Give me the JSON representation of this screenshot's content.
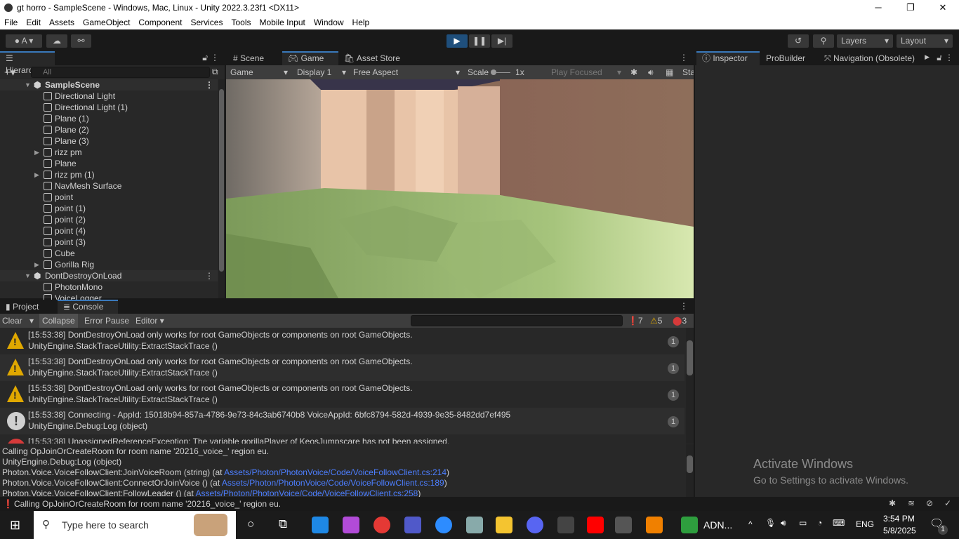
{
  "window": {
    "title": "gt horro - SampleScene - Windows, Mac, Linux - Unity 2022.3.23f1 <DX11>",
    "minimize": "─",
    "maximize": "❐",
    "close": "✕"
  },
  "menu": [
    "File",
    "Edit",
    "Assets",
    "GameObject",
    "Component",
    "Services",
    "Tools",
    "Mobile Input",
    "Window",
    "Help"
  ],
  "toolbar": {
    "account": "A",
    "layers": "Layers",
    "layout": "Layout"
  },
  "hierarchy": {
    "tab": "Hierarchy",
    "search_placeholder": "All",
    "scene": "SampleScene",
    "items": [
      {
        "label": "Directional Light"
      },
      {
        "label": "Directional Light (1)"
      },
      {
        "label": "Plane (1)"
      },
      {
        "label": "Plane (2)"
      },
      {
        "label": "Plane (3)"
      },
      {
        "label": "rizz pm",
        "expandable": true
      },
      {
        "label": "Plane"
      },
      {
        "label": "rizz pm (1)",
        "expandable": true
      },
      {
        "label": "NavMesh Surface"
      },
      {
        "label": "point"
      },
      {
        "label": "point (1)"
      },
      {
        "label": "point (2)"
      },
      {
        "label": "point (4)"
      },
      {
        "label": "point (3)"
      },
      {
        "label": "Cube"
      },
      {
        "label": "Gorilla Rig",
        "expandable": true
      }
    ],
    "scene2": "DontDestroyOnLoad",
    "items2": [
      {
        "label": "PhotonMono"
      },
      {
        "label": "VoiceLogger"
      }
    ]
  },
  "gameview": {
    "tabs": [
      "Scene",
      "Game",
      "Asset Store"
    ],
    "active_tab": "Game",
    "mode": "Game",
    "display": "Display 1",
    "aspect": "Free Aspect",
    "scale_label": "Scale",
    "scale_value": "1x",
    "play_focused": "Play Focused",
    "stats": "Sta"
  },
  "inspector": {
    "tabs": [
      "Inspector",
      "ProBuilder",
      "Navigation (Obsolete)"
    ],
    "watermark_title": "Activate Windows",
    "watermark_sub": "Go to Settings to activate Windows."
  },
  "console": {
    "tabs": [
      "Project",
      "Console"
    ],
    "active_tab": "Console",
    "clear": "Clear",
    "collapse": "Collapse",
    "error_pause": "Error Pause",
    "editor": "Editor",
    "info_count": "7",
    "warn_count": "5",
    "error_count": "3",
    "entries": [
      {
        "type": "warning",
        "line1": "[15:53:38] DontDestroyOnLoad only works for root GameObjects or components on root GameObjects.",
        "line2": "UnityEngine.StackTraceUtility:ExtractStackTrace ()",
        "count": "1"
      },
      {
        "type": "warning",
        "line1": "[15:53:38] DontDestroyOnLoad only works for root GameObjects or components on root GameObjects.",
        "line2": "UnityEngine.StackTraceUtility:ExtractStackTrace ()",
        "count": "1"
      },
      {
        "type": "warning",
        "line1": "[15:53:38] DontDestroyOnLoad only works for root GameObjects or components on root GameObjects.",
        "line2": "UnityEngine.StackTraceUtility:ExtractStackTrace ()",
        "count": "1"
      },
      {
        "type": "info",
        "line1": "[15:53:38] Connecting - AppId: 15018b94-857a-4786-9e73-84c3ab6740b8 VoiceAppId: 6bfc8794-582d-4939-9e35-8482dd7ef495",
        "line2": "UnityEngine.Debug:Log (object)",
        "count": "1"
      },
      {
        "type": "error",
        "line1": "[15:53:38] UnassignedReferenceException: The variable gorillaPlayer of KeosJumpscare has not been assigned.",
        "line2": "",
        "count": ""
      }
    ],
    "detail": [
      {
        "text": "Calling OpJoinOrCreateRoom for room name '20216_voice_' region eu.",
        "link": ""
      },
      {
        "text": "UnityEngine.Debug:Log (object)",
        "link": ""
      },
      {
        "text": "Photon.Voice.VoiceFollowClient:JoinVoiceRoom (string) (at ",
        "link": "Assets/Photon/PhotonVoice/Code/VoiceFollowClient.cs:214"
      },
      {
        "text": "Photon.Voice.VoiceFollowClient:ConnectOrJoinVoice () (at ",
        "link": "Assets/Photon/PhotonVoice/Code/VoiceFollowClient.cs:189"
      },
      {
        "text": "Photon.Voice.VoiceFollowClient:FollowLeader () (at ",
        "link": "Assets/Photon/PhotonVoice/Code/VoiceFollowClient.cs:258"
      }
    ]
  },
  "statusbar": {
    "message": "Calling OpJoinOrCreateRoom for room name '20216_voice_' region eu."
  },
  "taskbar": {
    "search_placeholder": "Type here to search",
    "app_label": "ADN...",
    "language": "ENG",
    "time": "3:54 PM",
    "date": "5/8/2025",
    "notifications": "1"
  }
}
